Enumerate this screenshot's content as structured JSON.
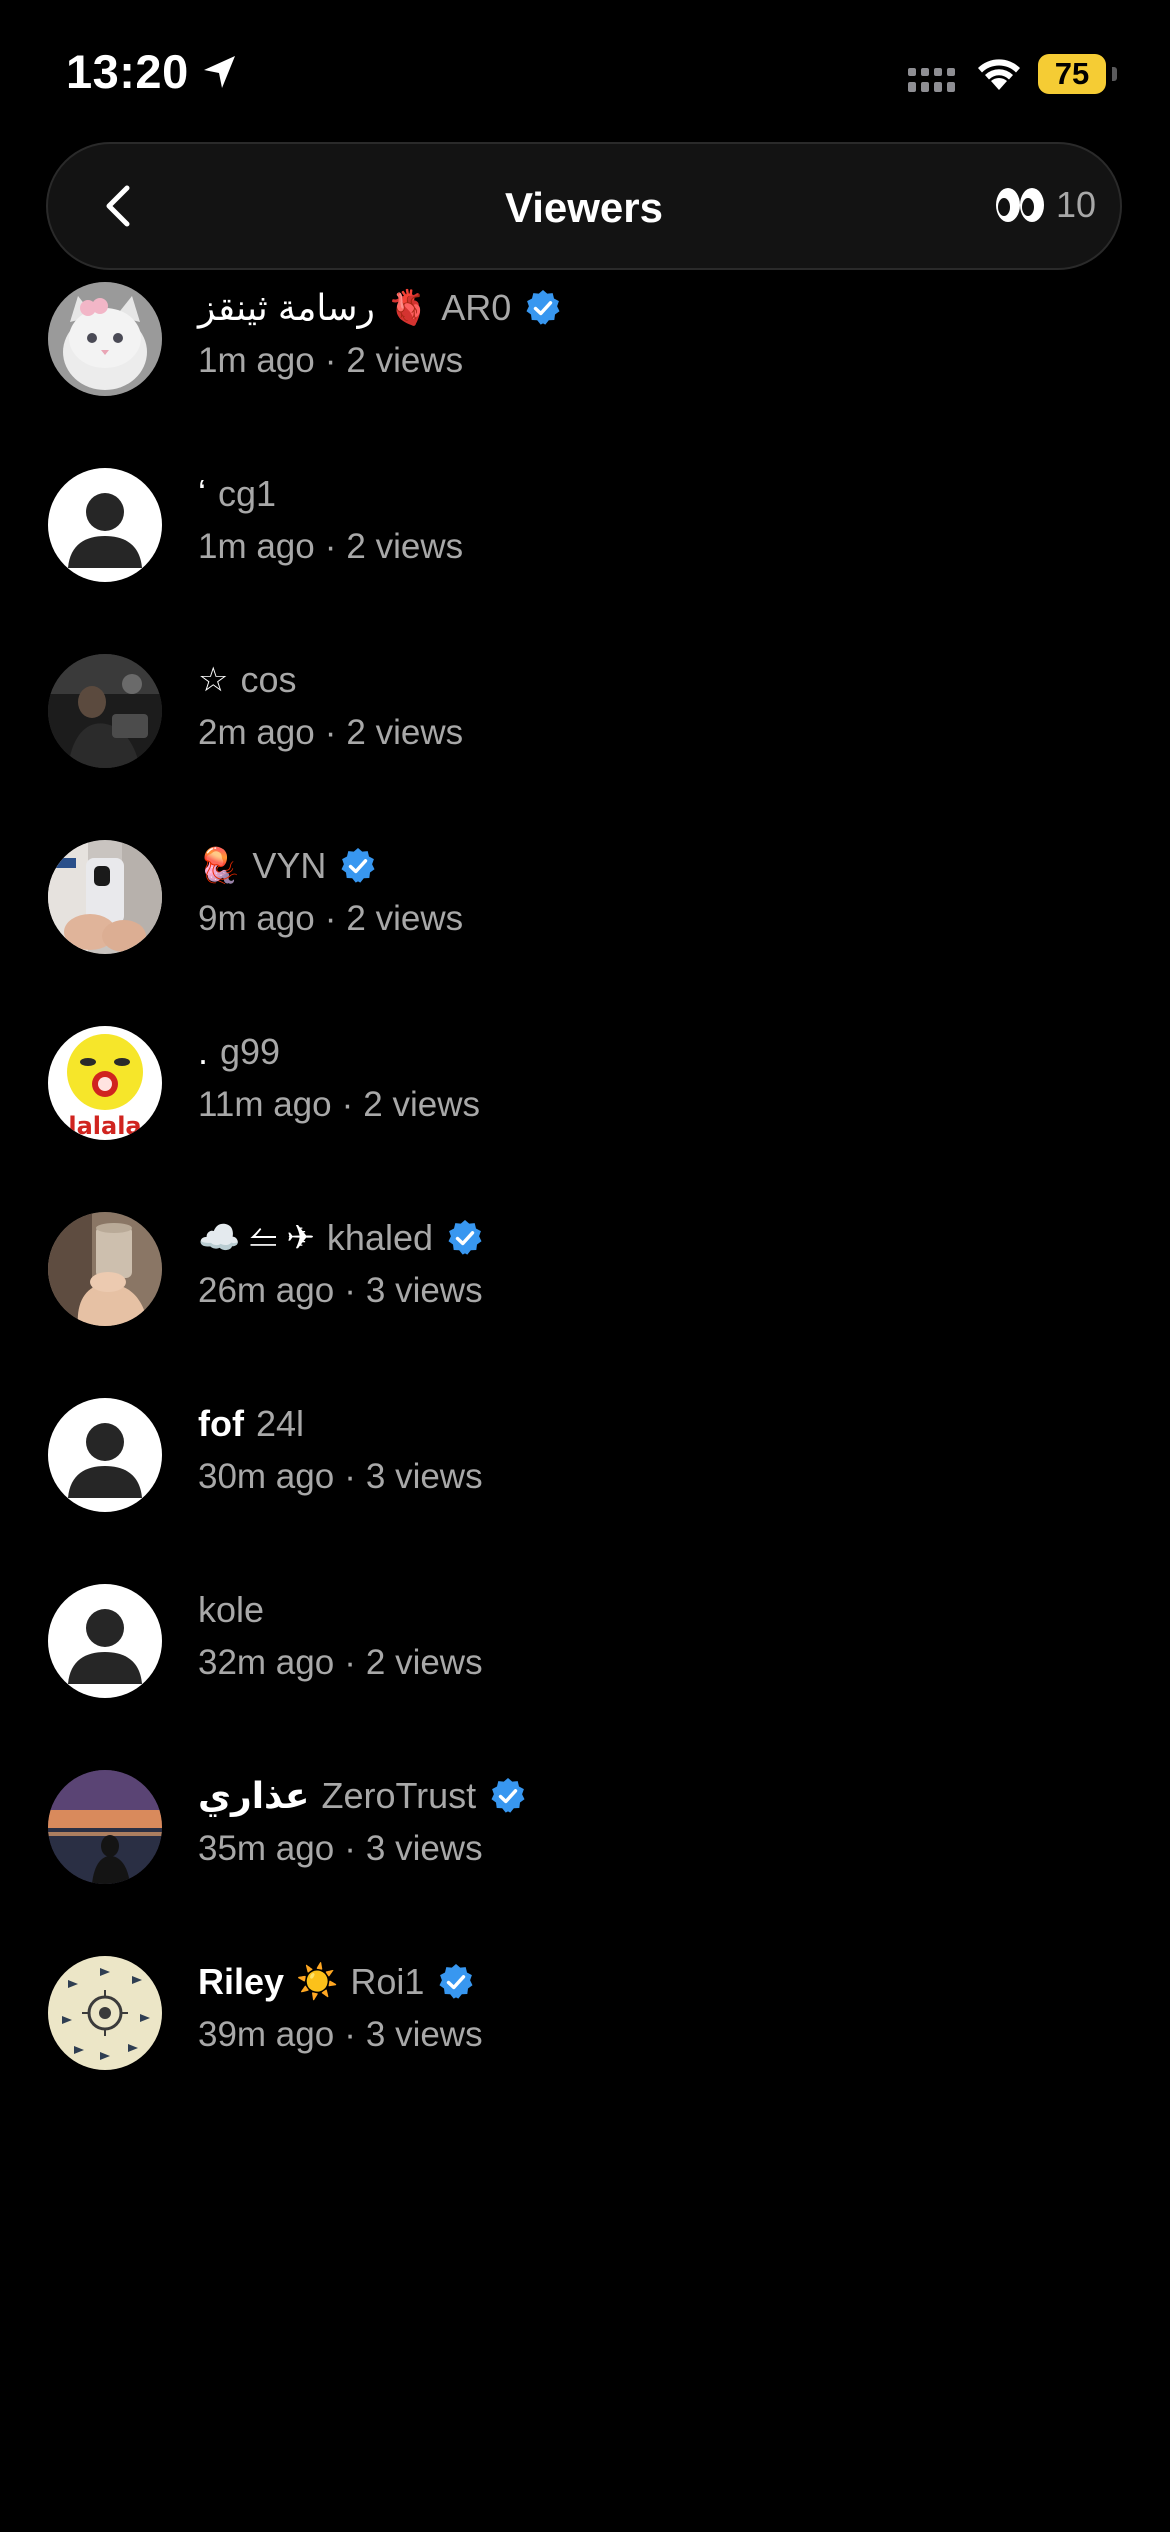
{
  "status_bar": {
    "time": "13:20",
    "battery": "75",
    "battery_color": "#f5cc34"
  },
  "header": {
    "title": "Viewers",
    "viewer_count": "10"
  },
  "viewers": [
    {
      "emoji_before": "",
      "display_name": "رسامة ثينقز",
      "emoji_after": "🫀",
      "name_bold": false,
      "username": "AR0",
      "verified": true,
      "time": "1m ago",
      "views": "2 views",
      "avatar": "white-cat"
    },
    {
      "emoji_before": "",
      "display_name": "ʻ",
      "emoji_after": "",
      "name_bold": false,
      "username": "cg1",
      "verified": false,
      "time": "1m ago",
      "views": "2 views",
      "avatar": "default"
    },
    {
      "emoji_before": "☆",
      "display_name": "",
      "emoji_after": "",
      "name_bold": false,
      "username": "cos",
      "verified": false,
      "time": "2m ago",
      "views": "2 views",
      "avatar": "dark-photo"
    },
    {
      "emoji_before": "🪼",
      "display_name": "",
      "emoji_after": "",
      "name_bold": false,
      "username": "VYN",
      "verified": true,
      "time": "9m ago",
      "views": "2 views",
      "avatar": "phone-selfie"
    },
    {
      "emoji_before": "",
      "display_name": ".",
      "emoji_after": "",
      "name_bold": false,
      "username": "g99",
      "verified": false,
      "time": "11m ago",
      "views": "2 views",
      "avatar": "yellow-face"
    },
    {
      "emoji_before": "☁️ ⥪ ✈",
      "display_name": "",
      "emoji_after": "",
      "name_bold": false,
      "username": "khaled",
      "verified": true,
      "time": "26m ago",
      "views": "3 views",
      "avatar": "hand-cup"
    },
    {
      "emoji_before": "",
      "display_name": "fof",
      "emoji_after": "",
      "name_bold": true,
      "username": "24l",
      "verified": false,
      "time": "30m ago",
      "views": "3 views",
      "avatar": "default"
    },
    {
      "emoji_before": "",
      "display_name": "",
      "emoji_after": "",
      "name_bold": false,
      "username": "kole",
      "verified": false,
      "time": "32m ago",
      "views": "2 views",
      "avatar": "default"
    },
    {
      "emoji_before": "",
      "display_name": "عذاري",
      "emoji_after": "",
      "name_bold": true,
      "username": "ZeroTrust",
      "verified": true,
      "time": "35m ago",
      "views": "3 views",
      "avatar": "sunset"
    },
    {
      "emoji_before": "",
      "display_name": "Riley",
      "emoji_after": "☀️",
      "name_bold": true,
      "username": "Roi1",
      "verified": true,
      "time": "39m ago",
      "views": "3 views",
      "avatar": "birds-pattern"
    }
  ],
  "colors": {
    "background": "#000000",
    "header_bg": "#131313",
    "secondary_text": "#a8a8a8",
    "verified_blue": "#3897f0"
  }
}
